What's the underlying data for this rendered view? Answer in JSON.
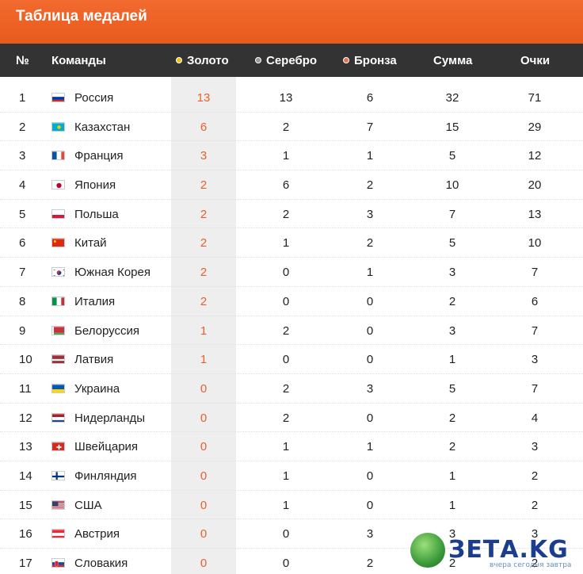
{
  "title": "Таблица медалей",
  "columns": {
    "num": "№",
    "team": "Команды",
    "gold": "Золото",
    "silver": "Серебро",
    "bronze": "Бронза",
    "sum": "Сумма",
    "points": "Очки"
  },
  "colors": {
    "header_bg": "#333333",
    "title_bg": "#f26a2e",
    "gold": "#f1c40f",
    "silver": "#9a9a9a",
    "bronze": "#e8734a",
    "gold_value": "#e8602c"
  },
  "rows": [
    {
      "num": "1",
      "team": "Россия",
      "flag": "flag-russia",
      "gold": "13",
      "silver": "13",
      "bronze": "6",
      "sum": "32",
      "points": "71"
    },
    {
      "num": "2",
      "team": "Казахстан",
      "flag": "flag-kazakhstan",
      "gold": "6",
      "silver": "2",
      "bronze": "7",
      "sum": "15",
      "points": "29"
    },
    {
      "num": "3",
      "team": "Франция",
      "flag": "flag-france",
      "gold": "3",
      "silver": "1",
      "bronze": "1",
      "sum": "5",
      "points": "12"
    },
    {
      "num": "4",
      "team": "Япония",
      "flag": "flag-japan",
      "gold": "2",
      "silver": "6",
      "bronze": "2",
      "sum": "10",
      "points": "20"
    },
    {
      "num": "5",
      "team": "Польша",
      "flag": "flag-poland",
      "gold": "2",
      "silver": "2",
      "bronze": "3",
      "sum": "7",
      "points": "13"
    },
    {
      "num": "6",
      "team": "Китай",
      "flag": "flag-china",
      "gold": "2",
      "silver": "1",
      "bronze": "2",
      "sum": "5",
      "points": "10"
    },
    {
      "num": "7",
      "team": "Южная Корея",
      "flag": "flag-south-korea",
      "gold": "2",
      "silver": "0",
      "bronze": "1",
      "sum": "3",
      "points": "7"
    },
    {
      "num": "8",
      "team": "Италия",
      "flag": "flag-italy",
      "gold": "2",
      "silver": "0",
      "bronze": "0",
      "sum": "2",
      "points": "6"
    },
    {
      "num": "9",
      "team": "Белоруссия",
      "flag": "flag-belarus",
      "gold": "1",
      "silver": "2",
      "bronze": "0",
      "sum": "3",
      "points": "7"
    },
    {
      "num": "10",
      "team": "Латвия",
      "flag": "flag-latvia",
      "gold": "1",
      "silver": "0",
      "bronze": "0",
      "sum": "1",
      "points": "3"
    },
    {
      "num": "11",
      "team": "Украина",
      "flag": "flag-ukraine",
      "gold": "0",
      "silver": "2",
      "bronze": "3",
      "sum": "5",
      "points": "7"
    },
    {
      "num": "12",
      "team": "Нидерланды",
      "flag": "flag-netherlands",
      "gold": "0",
      "silver": "2",
      "bronze": "0",
      "sum": "2",
      "points": "4"
    },
    {
      "num": "13",
      "team": "Швейцария",
      "flag": "flag-switzerland",
      "gold": "0",
      "silver": "1",
      "bronze": "1",
      "sum": "2",
      "points": "3"
    },
    {
      "num": "14",
      "team": "Финляндия",
      "flag": "flag-finland",
      "gold": "0",
      "silver": "1",
      "bronze": "0",
      "sum": "1",
      "points": "2"
    },
    {
      "num": "15",
      "team": "США",
      "flag": "flag-usa",
      "gold": "0",
      "silver": "1",
      "bronze": "0",
      "sum": "1",
      "points": "2"
    },
    {
      "num": "16",
      "team": "Австрия",
      "flag": "flag-austria",
      "gold": "0",
      "silver": "0",
      "bronze": "3",
      "sum": "3",
      "points": "3"
    },
    {
      "num": "17",
      "team": "Словакия",
      "flag": "flag-slovakia",
      "gold": "0",
      "silver": "0",
      "bronze": "2",
      "sum": "2",
      "points": "2"
    }
  ],
  "watermark": {
    "name": "ЗЕТА.KG",
    "tagline": "вчера сегодня завтра"
  }
}
